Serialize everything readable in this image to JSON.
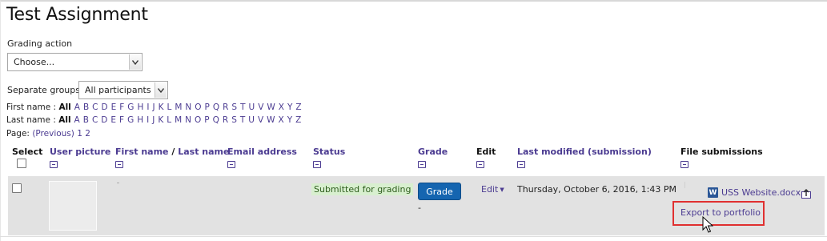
{
  "page": {
    "title": "Test Assignment"
  },
  "grading_action": {
    "label": "Grading action",
    "selected": "Choose..."
  },
  "groups": {
    "label": "Separate groups",
    "selected": "All participants"
  },
  "initials": {
    "first_label": "First name :",
    "last_label": "Last name :",
    "all_label": "All",
    "letters": [
      "A",
      "B",
      "C",
      "D",
      "E",
      "F",
      "G",
      "H",
      "I",
      "J",
      "K",
      "L",
      "M",
      "N",
      "O",
      "P",
      "Q",
      "R",
      "S",
      "T",
      "U",
      "V",
      "W",
      "X",
      "Y",
      "Z"
    ]
  },
  "pager": {
    "label": "Page:",
    "previous": "(Previous)",
    "page1": "1",
    "page2": "2"
  },
  "table": {
    "headers": {
      "select": "Select",
      "user_picture": "User picture",
      "first_name": "First name",
      "separator": " / ",
      "last_name": "Last name",
      "email": "Email address",
      "status": "Status",
      "grade": "Grade",
      "edit": "Edit",
      "last_modified": "Last modified (submission)",
      "file_submissions": "File submissions"
    },
    "row": {
      "status": "Submitted for grading",
      "grade_button": "Grade",
      "grade_value": "-",
      "edit_label": "Edit",
      "last_modified": "Thursday, October 6, 2016, 1:43 PM",
      "file_name": "USS Website.docx",
      "export_link": "Export to portfolio"
    }
  },
  "colors": {
    "link": "#4b3b91",
    "grade_button": "#1565b0",
    "status_bg": "#d8efcf",
    "highlight": "#e03030",
    "row_bg": "#e2e2e2"
  },
  "icons": [
    "chevron-down-icon",
    "collapse-column-icon",
    "word-document-icon",
    "portfolio-export-icon",
    "mouse-cursor-icon"
  ]
}
